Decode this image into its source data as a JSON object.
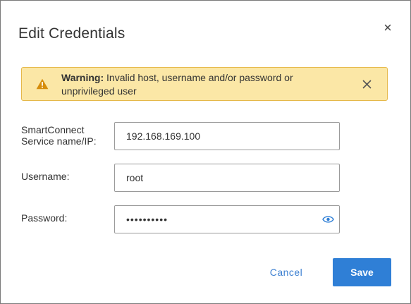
{
  "dialog": {
    "title": "Edit Credentials"
  },
  "warning": {
    "heading": "Warning:",
    "message": "Invalid host, username and/or password or unprivileged user",
    "icon": "warning-triangle-icon",
    "icon_color": "#d68d0b",
    "background": "#fbe7a6"
  },
  "form": {
    "host": {
      "label_line1": "SmartConnect",
      "label_line2": "Service name/IP:",
      "value": "192.168.169.100"
    },
    "username": {
      "label": "Username:",
      "value": "root"
    },
    "password": {
      "label": "Password:",
      "value": "••••••••••",
      "reveal_icon": "eye-icon"
    }
  },
  "actions": {
    "cancel_label": "Cancel",
    "save_label": "Save",
    "accent": "#2f7fd6"
  }
}
